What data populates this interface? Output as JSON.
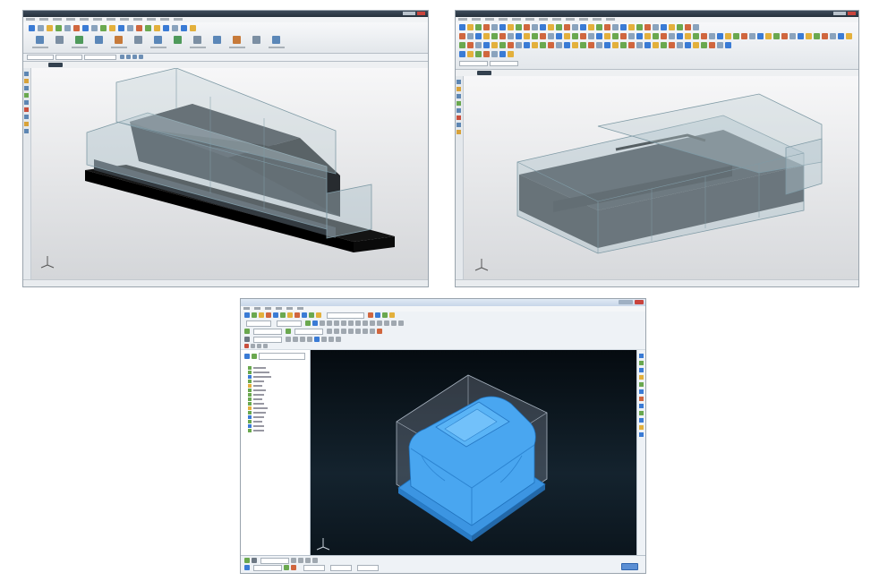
{
  "screenshots": [
    {
      "id": "shot-a",
      "viewport_background": "gradient-light-gray"
    },
    {
      "id": "shot-b",
      "viewport_background": "gradient-light-gray"
    },
    {
      "id": "shot-c",
      "viewport_background": "gradient-dark-navy"
    }
  ],
  "colors": {
    "cad_titlebar": "#2f3b47",
    "viewport_light": "#e9eaec",
    "viewport_dark": "#0d1a24",
    "model_dark": "#3a3f44",
    "stock_box": "#b8c9cf",
    "base_plate": "#111111",
    "mold_blue": "#3e9ee8",
    "window_titlebar_blue": "#c7d6e8"
  },
  "icons": {
    "axis_triad": "axis-triad-icon",
    "minimize_maximize": "window-controls-icon",
    "close": "close-icon"
  }
}
